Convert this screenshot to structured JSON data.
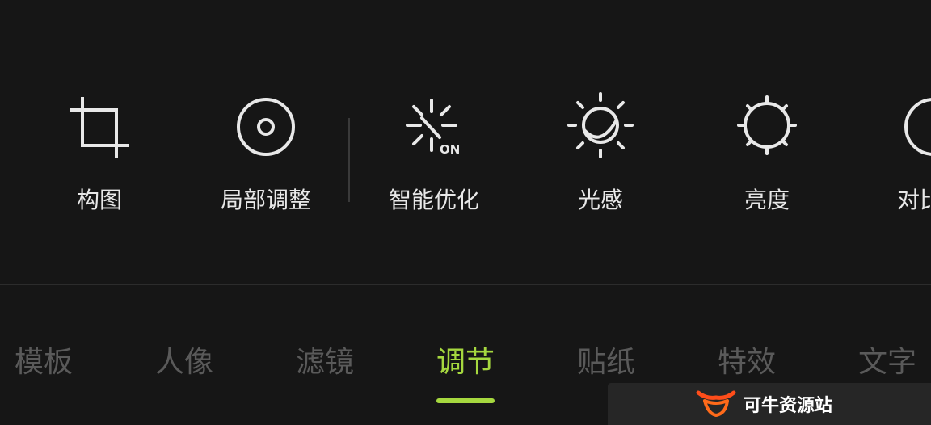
{
  "tools": [
    {
      "label": "构图",
      "icon": "crop-icon"
    },
    {
      "label": "局部调整",
      "icon": "target-icon"
    },
    {
      "label": "智能优化",
      "icon": "auto-enhance-icon",
      "badge": "ON"
    },
    {
      "label": "光感",
      "icon": "light-icon"
    },
    {
      "label": "亮度",
      "icon": "brightness-icon"
    },
    {
      "label": "对比",
      "icon": "contrast-icon"
    }
  ],
  "tabs": [
    {
      "label": "模板",
      "active": false
    },
    {
      "label": "人像",
      "active": false
    },
    {
      "label": "滤镜",
      "active": false
    },
    {
      "label": "调节",
      "active": true
    },
    {
      "label": "贴纸",
      "active": false
    },
    {
      "label": "特效",
      "active": false
    },
    {
      "label": "文字",
      "active": false
    }
  ],
  "watermark": {
    "text": "可牛资源站"
  },
  "colors": {
    "background": "#161616",
    "accent": "#a6d83f",
    "inactive_tab": "#5a5a5a",
    "icon": "#e8e8e8"
  }
}
